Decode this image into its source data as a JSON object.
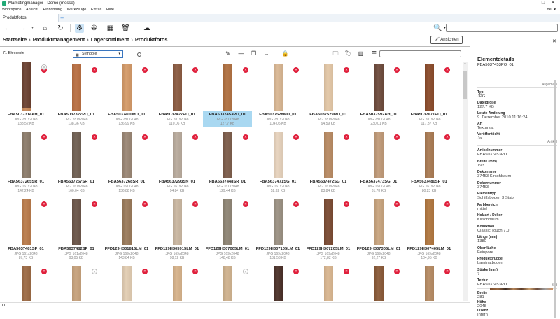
{
  "window": {
    "title": "Marketingmanager - Demo (messe)"
  },
  "menu": [
    "Workspace",
    "Ansicht",
    "Einrichtung",
    "Werkzeuge",
    "Extras",
    "Hilfe"
  ],
  "language": "de",
  "tabs": [
    {
      "label": "Produktfotos"
    }
  ],
  "breadcrumb": [
    "Startseite",
    "Produktmanagement",
    "Lagersortiment",
    "Produktfotos"
  ],
  "ansichten_label": "Ansichten",
  "element_count": "71 Elemente",
  "view_mode": "Symbole",
  "grid": [
    {
      "name": "FBA5037314AH_01",
      "type": "JPG",
      "dims": "281x2048",
      "size": "138,52 KB",
      "color": "#c98a5a",
      "flag": "red"
    },
    {
      "name": "FBA5037327PO_01",
      "type": "JPG",
      "dims": "281x2048",
      "size": "138,36 KB",
      "color": "#b96f42",
      "flag": "red"
    },
    {
      "name": "FBA5037400MO_01",
      "type": "JPG",
      "dims": "281x2048",
      "size": "136,99 KB",
      "color": "#d49a68",
      "flag": "red"
    },
    {
      "name": "FBA5037427PO_01",
      "type": "JPG",
      "dims": "281x2048",
      "size": "110,06 KB",
      "color": "#8a5a40",
      "flag": "red"
    },
    {
      "name": "FBA5037453PO_01",
      "type": "JPG",
      "dims": "281x2048",
      "size": "127,7 KB",
      "color": "#b07040",
      "flag": "red",
      "selected": true
    },
    {
      "name": "FBA5037528MO_01",
      "type": "JPG",
      "dims": "281x2048",
      "size": "104,05 KB",
      "color": "#d8b692",
      "flag": "red"
    },
    {
      "name": "FBA5037529MO_01",
      "type": "JPG",
      "dims": "281x2048",
      "size": "94,59 KB",
      "color": "#e3c7a6",
      "flag": "red"
    },
    {
      "name": "FBA5037592AH_01",
      "type": "JPG",
      "dims": "281x2048",
      "size": "230,01 KB",
      "color": "#6e4b3c",
      "flag": "red"
    },
    {
      "name": "FBA5037671PO_01",
      "type": "JPG",
      "dims": "281x2048",
      "size": "117,37 KB",
      "color": "#8a4a2a",
      "flag": "red"
    },
    {
      "name": "FBA5637265SR_01",
      "type": "JPG",
      "dims": "161x2048",
      "size": "142,24 KB",
      "color": "#8b7b6a",
      "flag": "red"
    },
    {
      "name": "FBA5637267SR_01",
      "type": "JPG",
      "dims": "161x2048",
      "size": "160,04 KB",
      "color": "#6f5f52",
      "flag": "red"
    },
    {
      "name": "FBA5637268SR_01",
      "type": "JPG",
      "dims": "161x2048",
      "size": "136,88 KB",
      "color": "#9a8674",
      "flag": "red"
    },
    {
      "name": "FBA5637293SN_01",
      "type": "JPG",
      "dims": "161x2048",
      "size": "94,84 KB",
      "color": "#b8aa9c",
      "flag": "red"
    },
    {
      "name": "FBA5637448SR_01",
      "type": "JPG",
      "dims": "161x2048",
      "size": "129,44 KB",
      "color": "#7c5c4a",
      "flag": "red"
    },
    {
      "name": "FBA5637471SG_01",
      "type": "JPG",
      "dims": "161x2048",
      "size": "52,32 KB",
      "color": "#e6d2bc",
      "flag": "red"
    },
    {
      "name": "FBA5637472SG_01",
      "type": "JPG",
      "dims": "161x2048",
      "size": "83,84 KB",
      "color": "#b88a62",
      "flag": "red"
    },
    {
      "name": "FBA5637473SG_01",
      "type": "JPG",
      "dims": "161x2048",
      "size": "81,78 KB",
      "color": "#c09a78",
      "flag": "red"
    },
    {
      "name": "FBA5637480SF_01",
      "type": "JPG",
      "dims": "161x2048",
      "size": "80,23 KB",
      "color": "#a97a52",
      "flag": "red"
    },
    {
      "name": "FBA5637481SF_01",
      "type": "JPG",
      "dims": "161x2048",
      "size": "87,73 KB",
      "color": "#b97a4a",
      "flag": "red"
    },
    {
      "name": "FBA5637482SF_01",
      "type": "JPG",
      "dims": "161x2048",
      "size": "93,05 KB",
      "color": "#6a5448",
      "flag": "red"
    },
    {
      "name": "FFD129H301815LM_01",
      "type": "JPG",
      "dims": "169x2048",
      "size": "143,84 KB",
      "color": "#9a7a5a",
      "flag": "red"
    },
    {
      "name": "FFD129H305915LM_01",
      "type": "JPG",
      "dims": "169x2048",
      "size": "98,12 KB",
      "color": "#c9b6a0",
      "flag": "red"
    },
    {
      "name": "FFD129H307005LM_01",
      "type": "JPG",
      "dims": "169x2048",
      "size": "148,48 KB",
      "color": "#8e8474",
      "flag": "red"
    },
    {
      "name": "FFD129H307105LM_01",
      "type": "JPG",
      "dims": "169x2048",
      "size": "131,53 KB",
      "color": "#9a9082",
      "flag": "red"
    },
    {
      "name": "FFD129H307205LM_01",
      "type": "JPG",
      "dims": "169x2048",
      "size": "172,82 KB",
      "color": "#7a4a32",
      "flag": "red"
    },
    {
      "name": "FFD129H307305LM_01",
      "type": "JPG",
      "dims": "169x2048",
      "size": "92,27 KB",
      "color": "#c8a47e",
      "flag": "red"
    },
    {
      "name": "FFD129H307405LM_01",
      "type": "JPG",
      "dims": "169x2048",
      "size": "104,95 KB",
      "color": "#b0763e",
      "flag": "red"
    },
    {
      "name": "",
      "type": "",
      "dims": "",
      "size": "",
      "color": "#9c6a44",
      "flag": "red"
    },
    {
      "name": "",
      "type": "",
      "dims": "",
      "size": "",
      "color": "#c7a27c",
      "flag": "off"
    },
    {
      "name": "",
      "type": "",
      "dims": "",
      "size": "",
      "color": "#e2cdb2",
      "flag": "red"
    },
    {
      "name": "",
      "type": "",
      "dims": "",
      "size": "",
      "color": "#d6b28a",
      "flag": "red"
    },
    {
      "name": "",
      "type": "",
      "dims": "",
      "size": "",
      "color": "#cfb28e",
      "flag": "off"
    },
    {
      "name": "",
      "type": "",
      "dims": "",
      "size": "",
      "color": "#4a3028",
      "flag": "red"
    },
    {
      "name": "",
      "type": "",
      "dims": "",
      "size": "",
      "color": "#d9b690",
      "flag": "red"
    },
    {
      "name": "",
      "type": "",
      "dims": "",
      "size": "",
      "color": "#8a5a38",
      "flag": "red"
    },
    {
      "name": "",
      "type": "",
      "dims": "",
      "size": "",
      "color": "#b58a62",
      "flag": "red"
    },
    {
      "name": "",
      "type": "",
      "dims": "",
      "size": "",
      "color": "#6a4030",
      "flag": "off"
    }
  ],
  "panel": {
    "title": "Elementdetails",
    "subtitle": "FBA5037453PO_01",
    "sections": {
      "allgemein": "Allgemein",
      "artikel": "Artikel",
      "bild": "Bild"
    },
    "fields_allgemein": [
      {
        "label": "Typ",
        "value": "JPG"
      },
      {
        "label": "Dateigröße",
        "value": "127,7 KB"
      },
      {
        "label": "Letzte Änderung",
        "value": "9. Dezember 2010 11:16:24"
      },
      {
        "label": "Art",
        "value": "Textursat"
      },
      {
        "label": "Veröffentlicht",
        "value": "Ja"
      }
    ],
    "fields_artikel": [
      {
        "label": "Artikelnummer",
        "value": "FBA5037453PO"
      },
      {
        "label": "Breite (mm)",
        "value": "193"
      },
      {
        "label": "Dekorname",
        "value": "37453 Kirschbaum"
      },
      {
        "label": "Dekornummer",
        "value": "37453"
      },
      {
        "label": "Elementtyp",
        "value": "Schiffsboden 3 Stab"
      },
      {
        "label": "Farbbereich",
        "value": "mittel"
      },
      {
        "label": "Holzart / Dekor",
        "value": "Kirschbaum"
      },
      {
        "label": "Kollektion",
        "value": "Classic Touch 7.0"
      },
      {
        "label": "Länge (mm)",
        "value": "1380"
      },
      {
        "label": "Oberfläche",
        "value": "Feinpore"
      },
      {
        "label": "Produktgruppe",
        "value": "Laminatboden"
      },
      {
        "label": "Stärke (mm)",
        "value": "7"
      },
      {
        "label": "Textur",
        "value": "FBA5037453PO"
      }
    ],
    "fields_bild": [
      {
        "label": "Breite",
        "value": "281"
      },
      {
        "label": "Höhe",
        "value": "2048"
      },
      {
        "label": "Lizenz",
        "value": "Intern"
      }
    ]
  },
  "accent_color": "#3a86d6",
  "flag_color": "#e0203c",
  "selected_color": "#a9d8f1"
}
